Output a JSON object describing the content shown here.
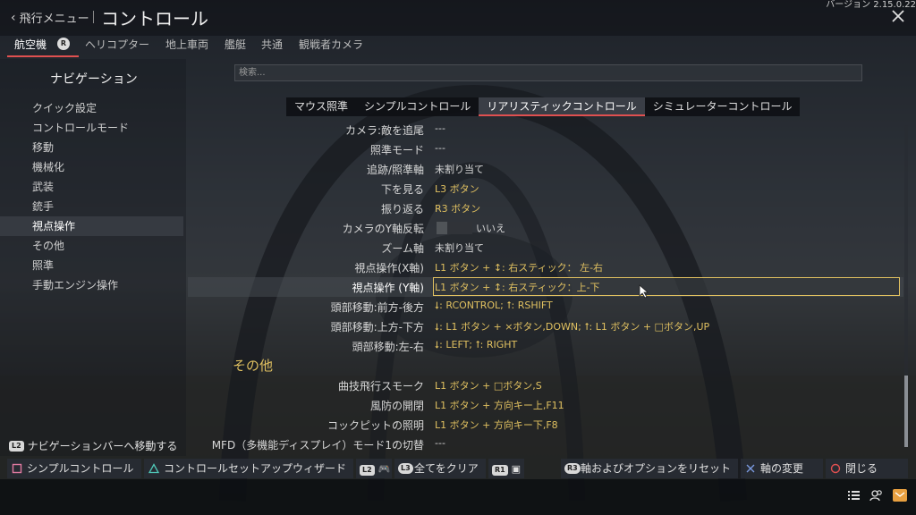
{
  "header": {
    "back_label": "飛行メニュー",
    "title": "コントロール",
    "version": "バージョン 2.15.0.22"
  },
  "vehicle_tabs": [
    "航空機",
    "ヘリコプター",
    "地上車両",
    "艦艇",
    "共通",
    "観戦者カメラ"
  ],
  "vehicle_tab_badge": "R",
  "sidebar": {
    "title": "ナビゲーション",
    "items": [
      "クイック設定",
      "コントロールモード",
      "移動",
      "機械化",
      "武装",
      "銃手",
      "視点操作",
      "その他",
      "照準",
      "手動エンジン操作"
    ],
    "selected": "視点操作",
    "hint_glyph": "L2",
    "hint": "ナビゲーションバーへ移動する"
  },
  "search": {
    "placeholder": "検索..."
  },
  "mode_tabs": [
    "マウス照準",
    "シンプルコントロール",
    "リアリスティックコントロール",
    "シミュレーターコントロール"
  ],
  "mode_tabs_active": "リアリスティックコントロール",
  "rows": [
    {
      "label": "カメラ:敵を追尾",
      "value": "---"
    },
    {
      "label": "照準モード",
      "value": "---"
    },
    {
      "label": "追跡/照準軸",
      "value": "未割り当て"
    },
    {
      "label": "下を見る",
      "value": "L3 ボタン"
    },
    {
      "label": "振り返る",
      "value": "R3 ボタン"
    },
    {
      "label": "カメラのY軸反転",
      "value": "いいえ"
    },
    {
      "label": "ズーム軸",
      "value": "未割り当て"
    },
    {
      "label": "視点操作(X軸)",
      "value": "L1 ボタン + ↕: 右スティック： 左-右"
    },
    {
      "label": "視点操作 (Y軸)",
      "value": "L1 ボタン + ↕: 右スティック：上-下"
    },
    {
      "label": "頭部移動:前方-後方",
      "value": "⭣: RCONTROL;  ⭡: RSHIFT"
    },
    {
      "label": "頭部移動:上方-下方",
      "value": "⭣: L1 ボタン + ×ボタン,DOWN;  ⭡: L1 ボタン + □ボタン,UP"
    },
    {
      "label": "頭部移動:左-右",
      "value": "⭣: LEFT;  ⭡: RIGHT"
    }
  ],
  "section_title": "その他",
  "rows2": [
    {
      "label": "曲技飛行スモーク",
      "value": "L1 ボタン + □ボタン,S"
    },
    {
      "label": "風防の開閉",
      "value": "L1 ボタン + 方向キー上,F11"
    },
    {
      "label": "コックピットの照明",
      "value": "L1 ボタン + 方向キー下,F8"
    },
    {
      "label": "MFD（多機能ディスプレイ）モード1の切替",
      "value": "---"
    }
  ],
  "bottom_bar": {
    "simple": "シンプルコントロール",
    "wizard": "コントロールセットアップウィザード",
    "l2_glyph": "L2",
    "clear_glyph": "L3",
    "clear": "全てをクリア",
    "r1_glyph": "R1",
    "reset_glyph": "R3",
    "reset": "軸およびオプションをリセット",
    "axis": "軸の変更",
    "close": "閉じる"
  },
  "colors": {
    "accent": "#e05050",
    "highlight": "#e0c060"
  }
}
